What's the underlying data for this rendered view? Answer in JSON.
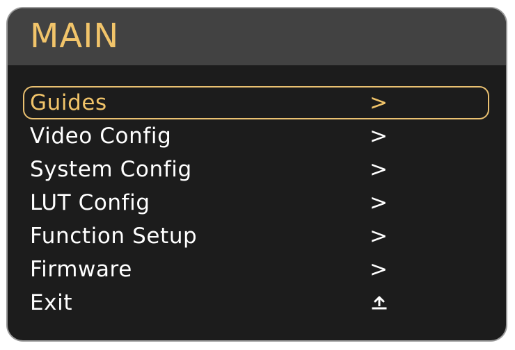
{
  "header": {
    "title": "MAIN"
  },
  "menu": {
    "items": [
      {
        "label": "Guides",
        "indicator": ">",
        "selected": true
      },
      {
        "label": "Video Config",
        "indicator": ">"
      },
      {
        "label": "System Config",
        "indicator": ">"
      },
      {
        "label": "LUT Config",
        "indicator": ">"
      },
      {
        "label": "Function Setup",
        "indicator": ">"
      },
      {
        "label": "Firmware",
        "indicator": ">"
      },
      {
        "label": "Exit",
        "indicator_icon": "return-icon"
      }
    ]
  },
  "colors": {
    "accent": "#f1c46a",
    "header_bg": "#424242",
    "panel_bg": "#1c1c1c",
    "text": "#ffffff"
  }
}
